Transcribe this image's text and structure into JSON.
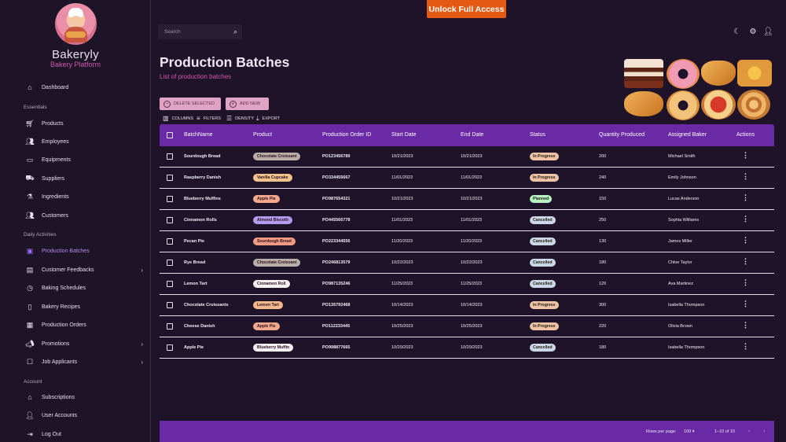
{
  "banner": {
    "unlock_label": "Unlock Full Access"
  },
  "brand": {
    "name": "Bakeryly",
    "subtitle": "Bakery Platform"
  },
  "search": {
    "placeholder": "Search"
  },
  "sidebar": {
    "dashboard": "Dashboard",
    "sections": {
      "essentials": "Essentials",
      "daily": "Daily Activities",
      "account": "Account"
    },
    "essentials": [
      "Products",
      "Employees",
      "Equipments",
      "Suppliers",
      "Ingredients",
      "Customers"
    ],
    "daily": [
      "Production Batches",
      "Customer Feedbacks",
      "Baking Schedules",
      "Bakery Recipes",
      "Production Orders",
      "Promotions",
      "Job Applicants"
    ],
    "account": [
      "Subscriptions",
      "User Accounts",
      "Log Out"
    ]
  },
  "header": {
    "title": "Production Batches",
    "subtitle": "List of production batches"
  },
  "toolbar": {
    "delete_label": "DELETE SELECTED",
    "add_label": "ADD NEW",
    "columns": "COLUMNS",
    "filters": "FILTERS",
    "density": "DENSITY",
    "export": "EXPORT"
  },
  "table": {
    "columns": [
      "BatchName",
      "Product",
      "Production Order ID",
      "Start Date",
      "End Date",
      "Status",
      "Quantity Produced",
      "Assigned Baker",
      "Actions"
    ],
    "rows": [
      {
        "batch": "Sourdough Bread",
        "product": "Chocolate Croissant",
        "order": "PO123456789",
        "start": "10/21/2023",
        "end": "10/21/2023",
        "status": "In Progress",
        "qty": "200",
        "baker": "Michael Smith"
      },
      {
        "batch": "Raspberry Danish",
        "product": "Vanilla Cupcake",
        "order": "PO334455667",
        "start": "11/01/2023",
        "end": "11/01/2023",
        "status": "In Progress",
        "qty": "240",
        "baker": "Emily Johnson"
      },
      {
        "batch": "Blueberry Muffins",
        "product": "Apple Pie",
        "order": "PO987654321",
        "start": "10/21/2023",
        "end": "10/21/2023",
        "status": "Planned",
        "qty": "150",
        "baker": "Lucas Anderson"
      },
      {
        "batch": "Cinnamon Rolls",
        "product": "Almond Biscotti",
        "order": "PO445566778",
        "start": "11/01/2023",
        "end": "11/01/2023",
        "status": "Cancelled",
        "qty": "250",
        "baker": "Sophia Williams"
      },
      {
        "batch": "Pecan Pie",
        "product": "Sourdough Bread",
        "order": "PO223344556",
        "start": "11/20/2023",
        "end": "11/20/2023",
        "status": "Cancelled",
        "qty": "130",
        "baker": "James Miller"
      },
      {
        "batch": "Rye Bread",
        "product": "Chocolate Croissant",
        "order": "PO246813579",
        "start": "10/22/2023",
        "end": "10/22/2023",
        "status": "Cancelled",
        "qty": "180",
        "baker": "Chloe Taylor"
      },
      {
        "batch": "Lemon Tart",
        "product": "Cinnamon Roll",
        "order": "PO987135246",
        "start": "11/25/2023",
        "end": "11/25/2023",
        "status": "Cancelled",
        "qty": "120",
        "baker": "Ava Martinez"
      },
      {
        "batch": "Chocolate Croissants",
        "product": "Lemon Tart",
        "order": "PO135792468",
        "start": "10/14/2023",
        "end": "10/14/2023",
        "status": "In Progress",
        "qty": "300",
        "baker": "Isabella Thompson"
      },
      {
        "batch": "Cheese Danish",
        "product": "Apple Pie",
        "order": "PO112233445",
        "start": "10/25/2023",
        "end": "10/25/2023",
        "status": "In Progress",
        "qty": "220",
        "baker": "Olivia Brown"
      },
      {
        "batch": "Apple Pie",
        "product": "Blueberry Muffin",
        "order": "PO998877665",
        "start": "10/20/2023",
        "end": "10/20/2023",
        "status": "Cancelled",
        "qty": "180",
        "baker": "Isabella Thompson"
      }
    ]
  },
  "pagination": {
    "rows_per_page_label": "Rows per page:",
    "rows_per_page": "100",
    "range": "1–10 of 10"
  },
  "colors": {
    "accent": "#6a2aa5",
    "unlock": "#e55a12",
    "subtitle_pink": "#d35aa8",
    "chips": {
      "Chocolate Croissant": "#b9aea6",
      "Vanilla Cupcake": "#f2c48c",
      "Apple Pie": "#f4a98e",
      "Almond Biscotti": "#b39cf0",
      "Sourdough Bread": "#f39a85",
      "Cinnamon Roll": "#f6f2f4",
      "Lemon Tart": "#f3b98a",
      "Blueberry Muffin": "#f6f2f4"
    },
    "status": {
      "In Progress": "#f0c2a6",
      "Planned": "#b9f2c4",
      "Cancelled": "#cbd7e6"
    }
  },
  "icons": {
    "search": "search-icon",
    "theme": "moon-icon",
    "settings": "gear-icon",
    "profile": "user-icon",
    "row_menu": "more-vertical-icon"
  }
}
